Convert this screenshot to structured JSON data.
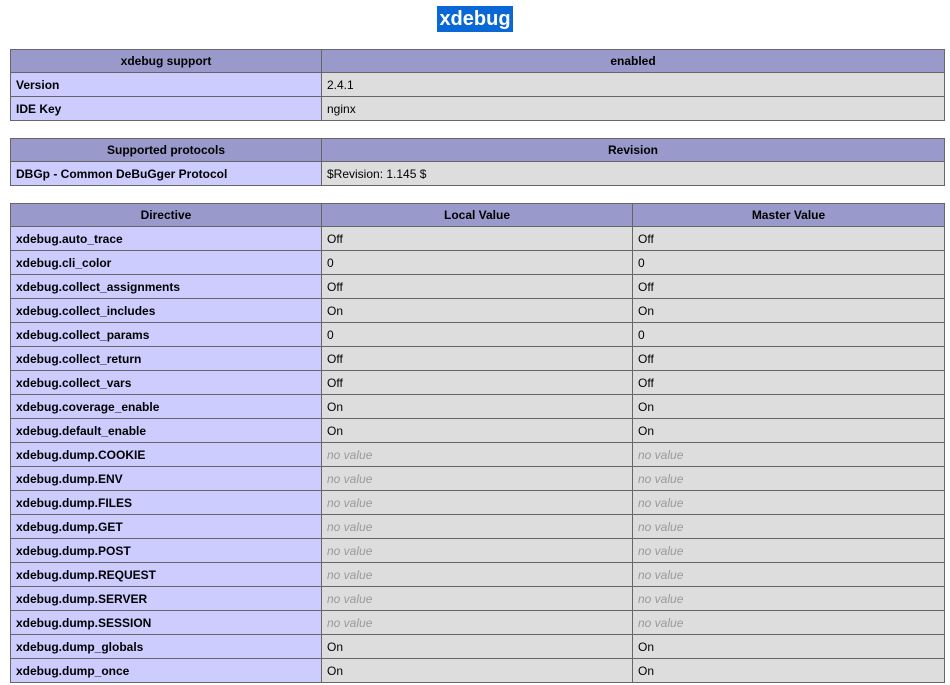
{
  "page": {
    "title": "xdebug"
  },
  "support_table": {
    "headers": [
      "xdebug support",
      "enabled"
    ],
    "rows": [
      {
        "name": "Version",
        "value": "2.4.1"
      },
      {
        "name": "IDE Key",
        "value": "nginx"
      }
    ]
  },
  "protocols_table": {
    "headers": [
      "Supported protocols",
      "Revision"
    ],
    "rows": [
      {
        "name": "DBGp - Common DeBuGger Protocol",
        "value": "$Revision: 1.145 $"
      }
    ]
  },
  "directives_table": {
    "headers": [
      "Directive",
      "Local Value",
      "Master Value"
    ],
    "rows": [
      {
        "name": "xdebug.auto_trace",
        "local": "Off",
        "master": "Off"
      },
      {
        "name": "xdebug.cli_color",
        "local": "0",
        "master": "0"
      },
      {
        "name": "xdebug.collect_assignments",
        "local": "Off",
        "master": "Off"
      },
      {
        "name": "xdebug.collect_includes",
        "local": "On",
        "master": "On"
      },
      {
        "name": "xdebug.collect_params",
        "local": "0",
        "master": "0"
      },
      {
        "name": "xdebug.collect_return",
        "local": "Off",
        "master": "Off"
      },
      {
        "name": "xdebug.collect_vars",
        "local": "Off",
        "master": "Off"
      },
      {
        "name": "xdebug.coverage_enable",
        "local": "On",
        "master": "On"
      },
      {
        "name": "xdebug.default_enable",
        "local": "On",
        "master": "On"
      },
      {
        "name": "xdebug.dump.COOKIE",
        "local": "no value",
        "master": "no value"
      },
      {
        "name": "xdebug.dump.ENV",
        "local": "no value",
        "master": "no value"
      },
      {
        "name": "xdebug.dump.FILES",
        "local": "no value",
        "master": "no value"
      },
      {
        "name": "xdebug.dump.GET",
        "local": "no value",
        "master": "no value"
      },
      {
        "name": "xdebug.dump.POST",
        "local": "no value",
        "master": "no value"
      },
      {
        "name": "xdebug.dump.REQUEST",
        "local": "no value",
        "master": "no value"
      },
      {
        "name": "xdebug.dump.SERVER",
        "local": "no value",
        "master": "no value"
      },
      {
        "name": "xdebug.dump.SESSION",
        "local": "no value",
        "master": "no value"
      },
      {
        "name": "xdebug.dump_globals",
        "local": "On",
        "master": "On"
      },
      {
        "name": "xdebug.dump_once",
        "local": "On",
        "master": "On"
      }
    ]
  },
  "colors": {
    "header_bg": "#9999cc",
    "name_cell_bg": "#ccccff",
    "value_cell_bg": "#dddddd",
    "title_highlight": "#0a68d6",
    "no_value_text": "#999999"
  }
}
